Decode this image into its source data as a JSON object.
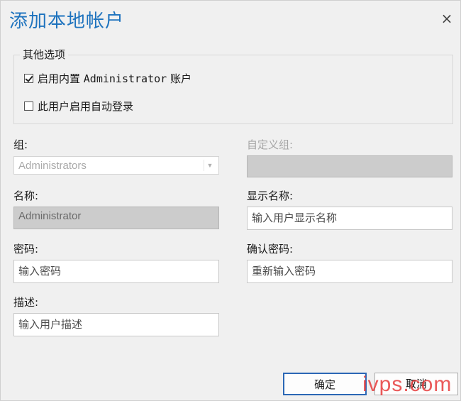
{
  "dialog": {
    "title": "添加本地帐户",
    "close_glyph": "×"
  },
  "options": {
    "legend": "其他选项",
    "enable_admin": {
      "label_prefix": "启用内置 ",
      "label_mono": "Administrator",
      "label_suffix": " 账户",
      "checked": true
    },
    "auto_login": {
      "label": "此用户启用自动登录",
      "checked": false
    }
  },
  "fields": {
    "group": {
      "label": "组:",
      "value": "Administrators"
    },
    "custom_group": {
      "label": "自定义组:",
      "value": ""
    },
    "name": {
      "label": "名称:",
      "value": "Administrator"
    },
    "display_name": {
      "label": "显示名称:",
      "placeholder": "输入用户显示名称"
    },
    "password": {
      "label": "密码:",
      "placeholder": "输入密码"
    },
    "confirm_password": {
      "label": "确认密码:",
      "placeholder": "重新输入密码"
    },
    "description": {
      "label": "描述:",
      "placeholder": "输入用户描述"
    }
  },
  "buttons": {
    "ok": "确定",
    "cancel": "取消"
  },
  "watermark": "ivps.com",
  "colors": {
    "title": "#1e73be",
    "primary_border": "#2b67b5",
    "watermark": "#e63c3c"
  }
}
